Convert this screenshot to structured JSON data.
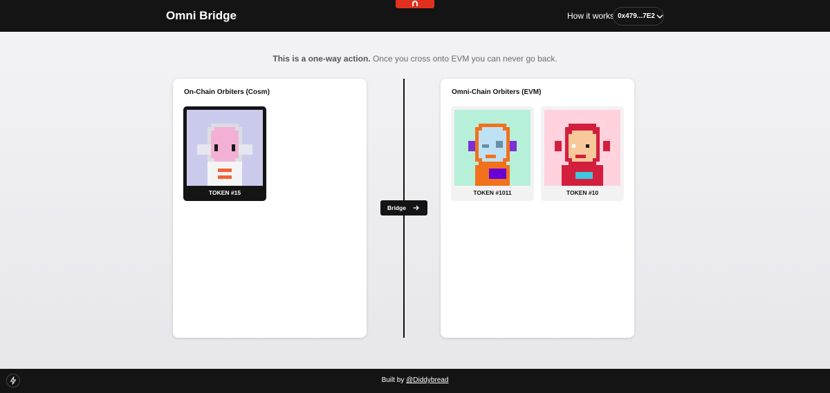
{
  "header": {
    "title": "Omni Bridge",
    "how_it_works": "How it works",
    "wallet": "0x479...7E2"
  },
  "notice": {
    "bold": "This is a one-way action.",
    "rest": " Once you cross onto EVM you can never go back."
  },
  "left_panel": {
    "title": "On-Chain Orbiters (Cosm)",
    "tokens": [
      {
        "label": "TOKEN #15",
        "selected": true,
        "bg": "#cacbec",
        "suit": "#f4f4f4",
        "face": "#f2b1d4"
      }
    ]
  },
  "right_panel": {
    "title": "Omni-Chain Orbiters (EVM)",
    "tokens": [
      {
        "label": "TOKEN #1011",
        "selected": false,
        "bg": "#b7f0d8",
        "suit": "#f2711c",
        "face": "#bfe1f6"
      },
      {
        "label": "TOKEN #10",
        "selected": false,
        "bg": "#ffd2dd",
        "suit": "#d31f3e",
        "face": "#f6c89a"
      }
    ]
  },
  "bridge": {
    "label": "Bridge"
  },
  "footer": {
    "prefix": "Built by ",
    "link": "@Diddybread"
  },
  "colors": {
    "bar": "#141414",
    "accent_tab": "#e0311f",
    "page": "#eeeef1"
  },
  "icons": [
    "chevron-down-icon",
    "arrow-right-icon",
    "bolt-icon",
    "logo-icon"
  ]
}
